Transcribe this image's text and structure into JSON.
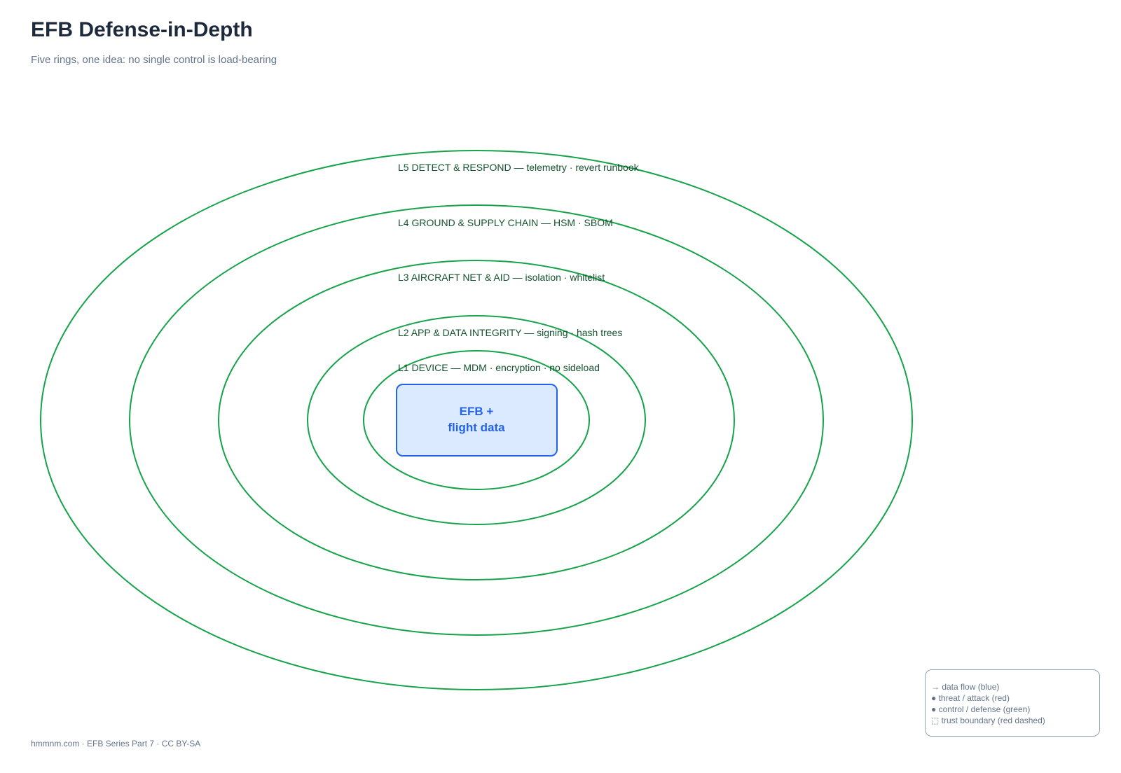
{
  "header": {
    "title": "EFB Defense-in-Depth",
    "subtitle": "Five rings, one idea: no single control is load-bearing"
  },
  "diagram": {
    "rings": [
      {
        "id": "l5",
        "label": "L5 DETECT & RESPOND — telemetry · revert runbook"
      },
      {
        "id": "l4",
        "label": "L4 GROUND & SUPPLY CHAIN — HSM · SBOM"
      },
      {
        "id": "l3",
        "label": "L3 AIRCRAFT NET & AID — isolation · whitelist"
      },
      {
        "id": "l2",
        "label": "L2 APP & DATA INTEGRITY — signing · hash trees"
      },
      {
        "id": "l1",
        "label": "L1 DEVICE — MDM · encryption · no sideload"
      }
    ],
    "core": {
      "line1": "EFB +",
      "line2": "flight data"
    }
  },
  "legend": {
    "items": [
      "→ data flow (blue)",
      "● threat / attack (red)",
      "● control / defense (green)",
      "⬚ trust boundary (red dashed)"
    ]
  },
  "footer": {
    "text": "hmmnm.com · EFB Series Part 7 · CC BY-SA"
  },
  "colors": {
    "ring_stroke": "#16a34a",
    "ring_label": "#14532d",
    "core_fill": "#dbeafe",
    "core_stroke": "#2563eb",
    "core_text": "#2563eb",
    "title": "#1e293b",
    "muted": "#64748b"
  }
}
